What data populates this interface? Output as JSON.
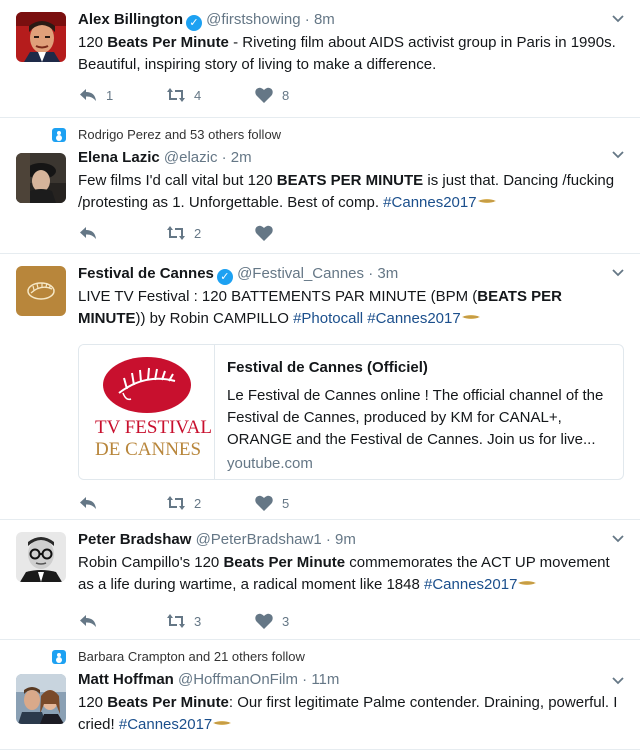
{
  "tweets": [
    {
      "name": "Alex Billington",
      "verified": true,
      "handle": "@firstshowing",
      "time": "8m",
      "text_parts": [
        "120 ",
        "Beats Per Minute",
        " - Riveting film about AIDS activist group in Paris in 1990s. Beautiful, inspiring story of living to make a difference."
      ],
      "replies": "1",
      "retweets": "4",
      "likes": "8"
    },
    {
      "context": "Rodrigo Perez and 53 others follow",
      "name": "Elena Lazic",
      "handle": "@elazic",
      "time": "2m",
      "text_parts": [
        "Few films I'd call vital but 120 ",
        "BEATS PER MINUTE",
        " is just that. Dancing /fucking /protesting as 1. Unforgettable. Best of comp. ",
        "#Cannes2017"
      ],
      "replies": "",
      "retweets": "2",
      "likes": ""
    },
    {
      "name": "Festival de Cannes",
      "verified": true,
      "handle": "@Festival_Cannes",
      "time": "3m",
      "text_parts": [
        "LIVE TV Festival : 120 BATTEMENTS PAR MINUTE (BPM (",
        "BEATS PER MINUTE",
        ")) by Robin CAMPILLO ",
        "#Photocall",
        " ",
        "#Cannes2017"
      ],
      "card": {
        "title": "Festival de Cannes (Officiel)",
        "description": "Le Festival de Cannes online ! The official channel of the Festival de Cannes, produced by KM for CANAL+, ORANGE and the Festival de Cannes. Join us for live...",
        "url": "youtube.com",
        "logo_line1": "TV FESTIVAL",
        "logo_line2": "DE CANNES"
      },
      "replies": "",
      "retweets": "2",
      "likes": "5"
    },
    {
      "name": "Peter Bradshaw",
      "handle": "@PeterBradshaw1",
      "time": "9m",
      "text_parts": [
        "Robin Campillo's 120 ",
        "Beats Per Minute",
        " commemorates the ACT UP movement as a life during wartime, a radical moment like 1848 ",
        "#Cannes2017"
      ],
      "replies": "",
      "retweets": "3",
      "likes": "3"
    },
    {
      "context": "Barbara Crampton and 21 others follow",
      "name": "Matt Hoffman",
      "handle": "@HoffmanOnFilm",
      "time": "11m",
      "text_parts": [
        "120 ",
        "Beats Per Minute",
        ": Our first legitimate Palme contender. Draining, powerful. I cried! ",
        "#Cannes2017"
      ]
    }
  ],
  "sep": "·",
  "colors": {
    "accent": "#1da1f2",
    "hashtag": "#1b4f8c",
    "muted": "#657786",
    "cannes_red": "#c8102e",
    "cannes_gold": "#b8863b"
  }
}
